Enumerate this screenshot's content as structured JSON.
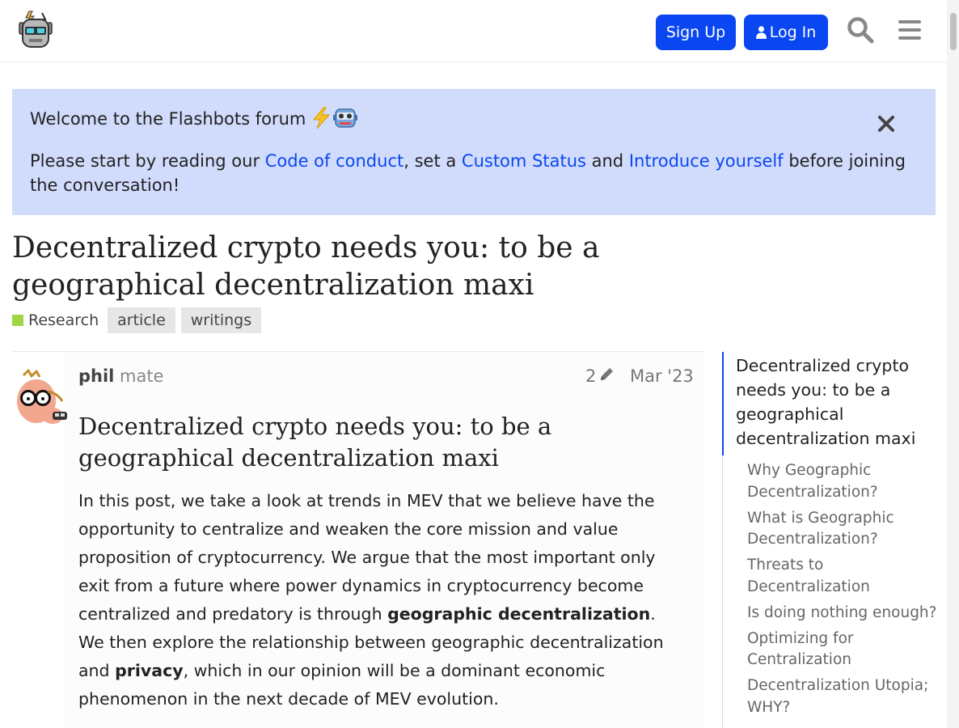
{
  "header": {
    "signup_label": "Sign Up",
    "login_label": "Log In"
  },
  "banner": {
    "title": "Welcome to the Flashbots forum",
    "text_1": "Please start by reading our ",
    "link_1": "Code of conduct",
    "text_2": ", set a ",
    "link_2": "Custom Status",
    "text_3": " and ",
    "link_3": "Introduce yourself",
    "text_4": " before joining the conversation!"
  },
  "topic": {
    "title": "Decentralized crypto needs you: to be a geographical decentralization maxi",
    "category": "Research",
    "tags": [
      "article",
      "writings"
    ]
  },
  "post": {
    "username": "phil",
    "user_title": "mate",
    "edit_count": "2",
    "date": "Mar '23",
    "heading": "Decentralized crypto needs you: to be a geographical decentralization maxi",
    "p1": "In this post, we take a look at trends in MEV that we believe have the opportunity to centralize and weaken the core mission and value proposition of cryptocurrency. We argue that the most important only exit from a future where power dynamics in cryptocurrency become centralized and predatory is through ",
    "b1": "geographic decentralization",
    "p2": ". We then explore the relationship between geographic decentralization and ",
    "b2": "privacy",
    "p3": ", which in our opinion will be a dominant economic phenomenon in the next decade of MEV evolution."
  },
  "toc": {
    "main": "Decentralized crypto needs you: to be a geographical decentralization maxi",
    "items": [
      "Why Geographic Decentralization?",
      "What is Geographic Decentralization?",
      "Threats to Decentralization",
      "Is doing nothing enough?",
      "Optimizing for Centralization",
      "Decentralization Utopia; WHY?"
    ]
  },
  "colors": {
    "accent": "#0a47f2",
    "banner_bg": "#d1dcfc",
    "category": "#9fd646"
  },
  "icons": [
    "robot-logo-icon",
    "user-icon",
    "search-icon",
    "hamburger-menu-icon",
    "lightning-emoji-icon",
    "robot-emoji-icon",
    "close-icon",
    "pencil-icon"
  ]
}
